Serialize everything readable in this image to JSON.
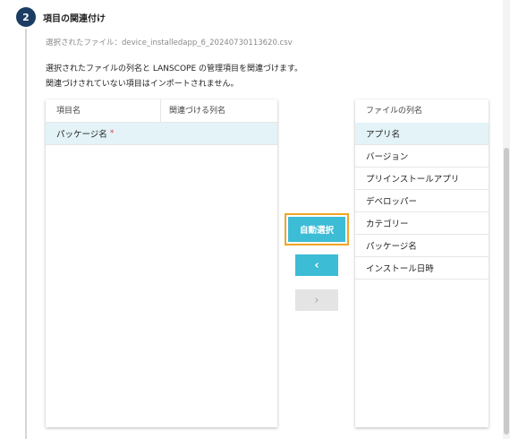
{
  "step": {
    "number": "2",
    "title": "項目の関連付け"
  },
  "file_label": "選択されたファイル：device_installedapp_6_20240730113620.csv",
  "description": {
    "line1": "選択されたファイルの列名と LANSCOPE の管理項目を関連づけます。",
    "line2": "関連づけされていない項目はインポートされません。"
  },
  "left_table": {
    "headers": [
      "項目名",
      "関連づける列名"
    ],
    "rows": [
      {
        "item": "パッケージ名",
        "required_mark": "*",
        "mapped": ""
      }
    ]
  },
  "buttons": {
    "auto_select": "自動選択",
    "move_left": "‹",
    "move_right": "›"
  },
  "right_list": {
    "header": "ファイルの列名",
    "items": [
      "アプリ名",
      "バージョン",
      "プリインストールアプリ",
      "デベロッパー",
      "カテゴリー",
      "パッケージ名",
      "インストール日時"
    ],
    "selected_index": 0
  },
  "colors": {
    "accent": "#3dbcd6",
    "badge": "#1c3d63",
    "highlight_border": "#f0a526",
    "selected_row": "#e3f3f8",
    "required": "#e0463a"
  }
}
